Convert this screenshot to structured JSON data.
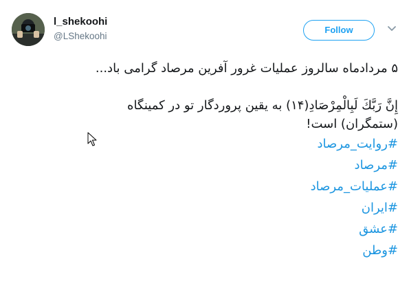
{
  "tweet": {
    "author": {
      "display_name": "l_shekoohi",
      "screen_name": "@LShekoohi",
      "avatar_icon": "user-avatar-photo"
    },
    "follow_label": "Follow",
    "menu_icon": "chevron-down-icon",
    "text_lines": [
      "۵ مردادماه سالروز عملیات غرور آفرین مرصاد گرامی باد...",
      "",
      "إِنَّ رَبَّكَ لَبِالْمِرْصَادِ(۱۴) به یقین پروردگار تو در کمینگاه",
      "(ستمگران) است!"
    ],
    "hashtags": [
      "#روایت_مرصاد",
      "#مرصاد",
      "#عملیات_مرصاد",
      "#ایران",
      "#عشق",
      "#وطن"
    ]
  },
  "colors": {
    "link": "#1b95e0",
    "follow_border": "#1da1f2",
    "secondary_text": "#657786",
    "primary_text": "#14171a"
  }
}
